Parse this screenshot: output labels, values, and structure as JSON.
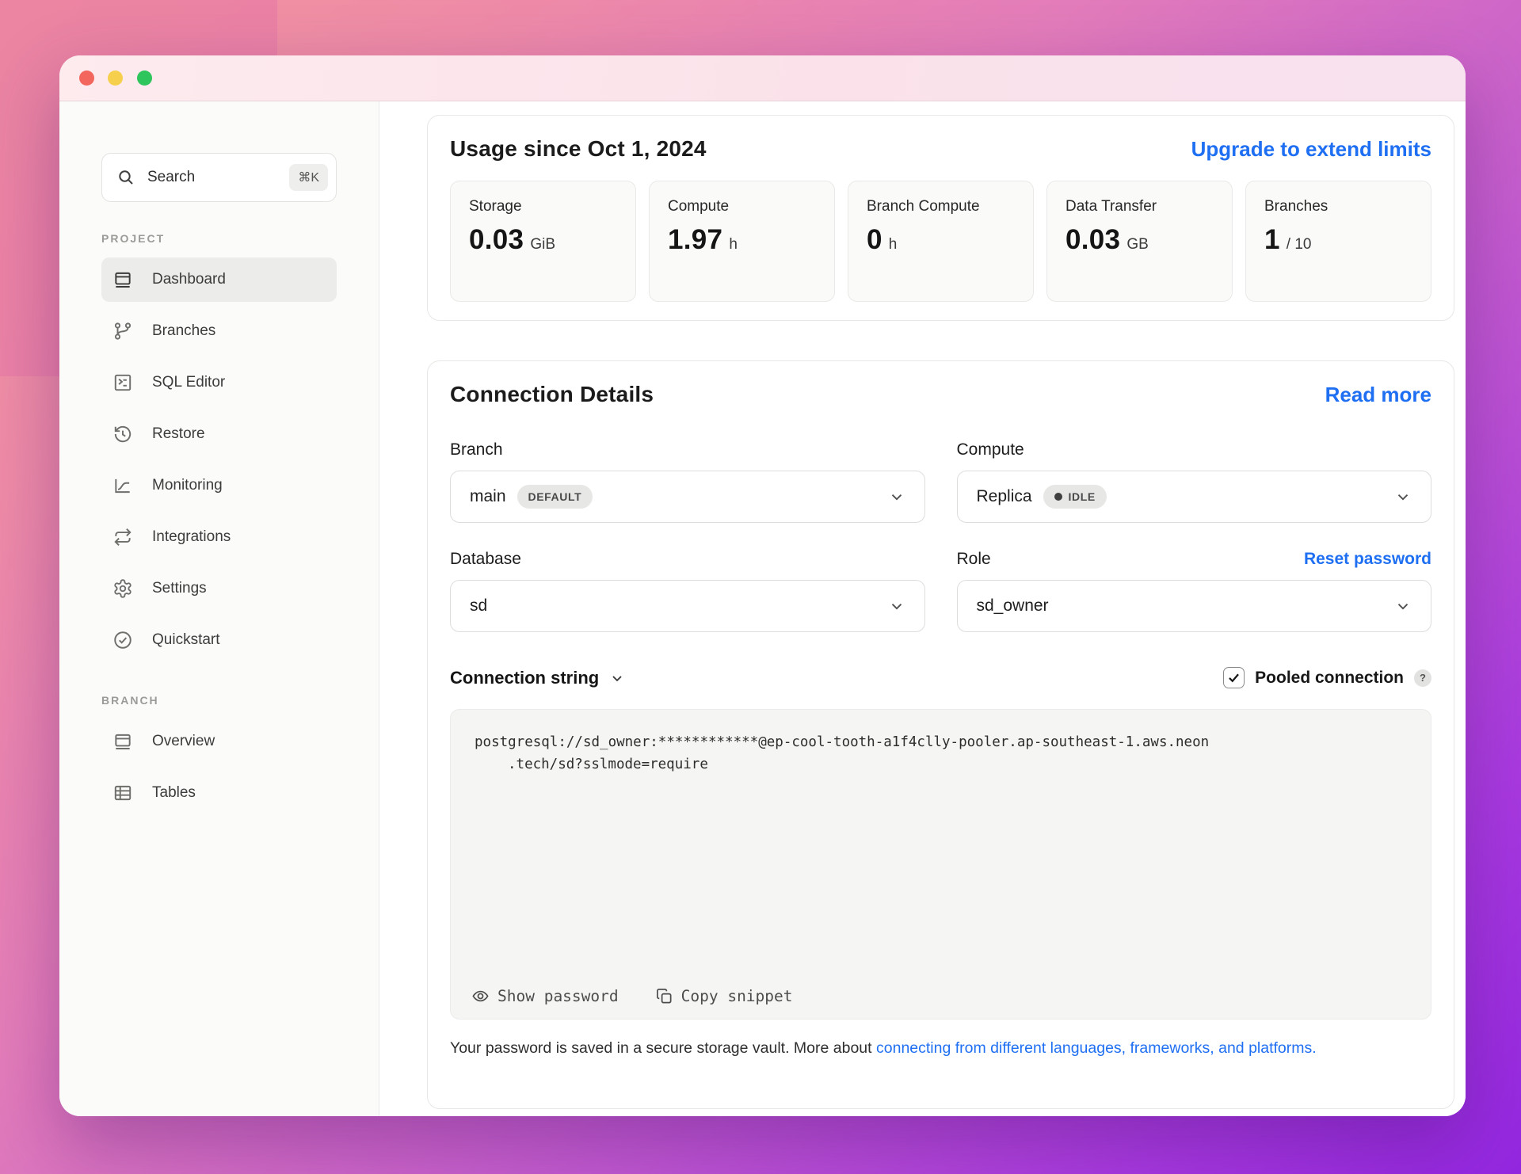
{
  "colors": {
    "accent_blue": "#1f6ff2",
    "bg_gradient_start": "#f2949e",
    "bg_gradient_end": "#9327e0",
    "traffic_red": "#f2665e",
    "traffic_yellow": "#f6d04d",
    "traffic_green": "#2ec55c",
    "active_item_bg": "#ececea",
    "codeblock_bg": "#f5f5f3"
  },
  "sidebar": {
    "search": {
      "placeholder": "Search",
      "shortcut": "⌘K",
      "icon": "search-icon"
    },
    "sections": [
      {
        "label": "PROJECT",
        "items": [
          {
            "label": "Dashboard",
            "icon": "dashboard-icon",
            "active": true
          },
          {
            "label": "Branches",
            "icon": "branches-icon",
            "active": false
          },
          {
            "label": "SQL Editor",
            "icon": "sql-editor-icon",
            "active": false
          },
          {
            "label": "Restore",
            "icon": "restore-icon",
            "active": false
          },
          {
            "label": "Monitoring",
            "icon": "monitoring-icon",
            "active": false
          },
          {
            "label": "Integrations",
            "icon": "integrations-icon",
            "active": false
          },
          {
            "label": "Settings",
            "icon": "gear-icon",
            "active": false
          },
          {
            "label": "Quickstart",
            "icon": "check-circle-icon",
            "active": false
          }
        ]
      },
      {
        "label": "BRANCH",
        "items": [
          {
            "label": "Overview",
            "icon": "overview-icon",
            "active": false
          },
          {
            "label": "Tables",
            "icon": "tables-icon",
            "active": false
          }
        ]
      }
    ]
  },
  "usage": {
    "title": "Usage since Oct 1, 2024",
    "upgrade_link": "Upgrade to extend limits",
    "stats": [
      {
        "label": "Storage",
        "value": "0.03",
        "unit": "GiB"
      },
      {
        "label": "Compute",
        "value": "1.97",
        "unit": "h"
      },
      {
        "label": "Branch Compute",
        "value": "0",
        "unit": "h"
      },
      {
        "label": "Data Transfer",
        "value": "0.03",
        "unit": "GB"
      },
      {
        "label": "Branches",
        "value": "1",
        "unit": "/ 10"
      }
    ]
  },
  "connection": {
    "title": "Connection Details",
    "read_more": "Read more",
    "branch": {
      "label": "Branch",
      "value": "main",
      "badge": "DEFAULT"
    },
    "compute": {
      "label": "Compute",
      "value": "Replica",
      "badge": "IDLE"
    },
    "database": {
      "label": "Database",
      "value": "sd"
    },
    "role": {
      "label": "Role",
      "value": "sd_owner",
      "action": "Reset password"
    },
    "string_section": {
      "label": "Connection string",
      "pooled_label": "Pooled connection",
      "help": "?"
    },
    "code": {
      "line1": "postgresql://sd_owner:************@ep-cool-tooth-a1f4clly-pooler.ap-southeast-1.aws.neon",
      "line2": ".tech/sd?sslmode=require"
    },
    "actions": {
      "show_password": "Show password",
      "copy_snippet": "Copy snippet"
    },
    "footer": {
      "text": "Your password is saved in a secure storage vault. More about ",
      "link": "connecting from different languages, frameworks, and platforms."
    }
  }
}
